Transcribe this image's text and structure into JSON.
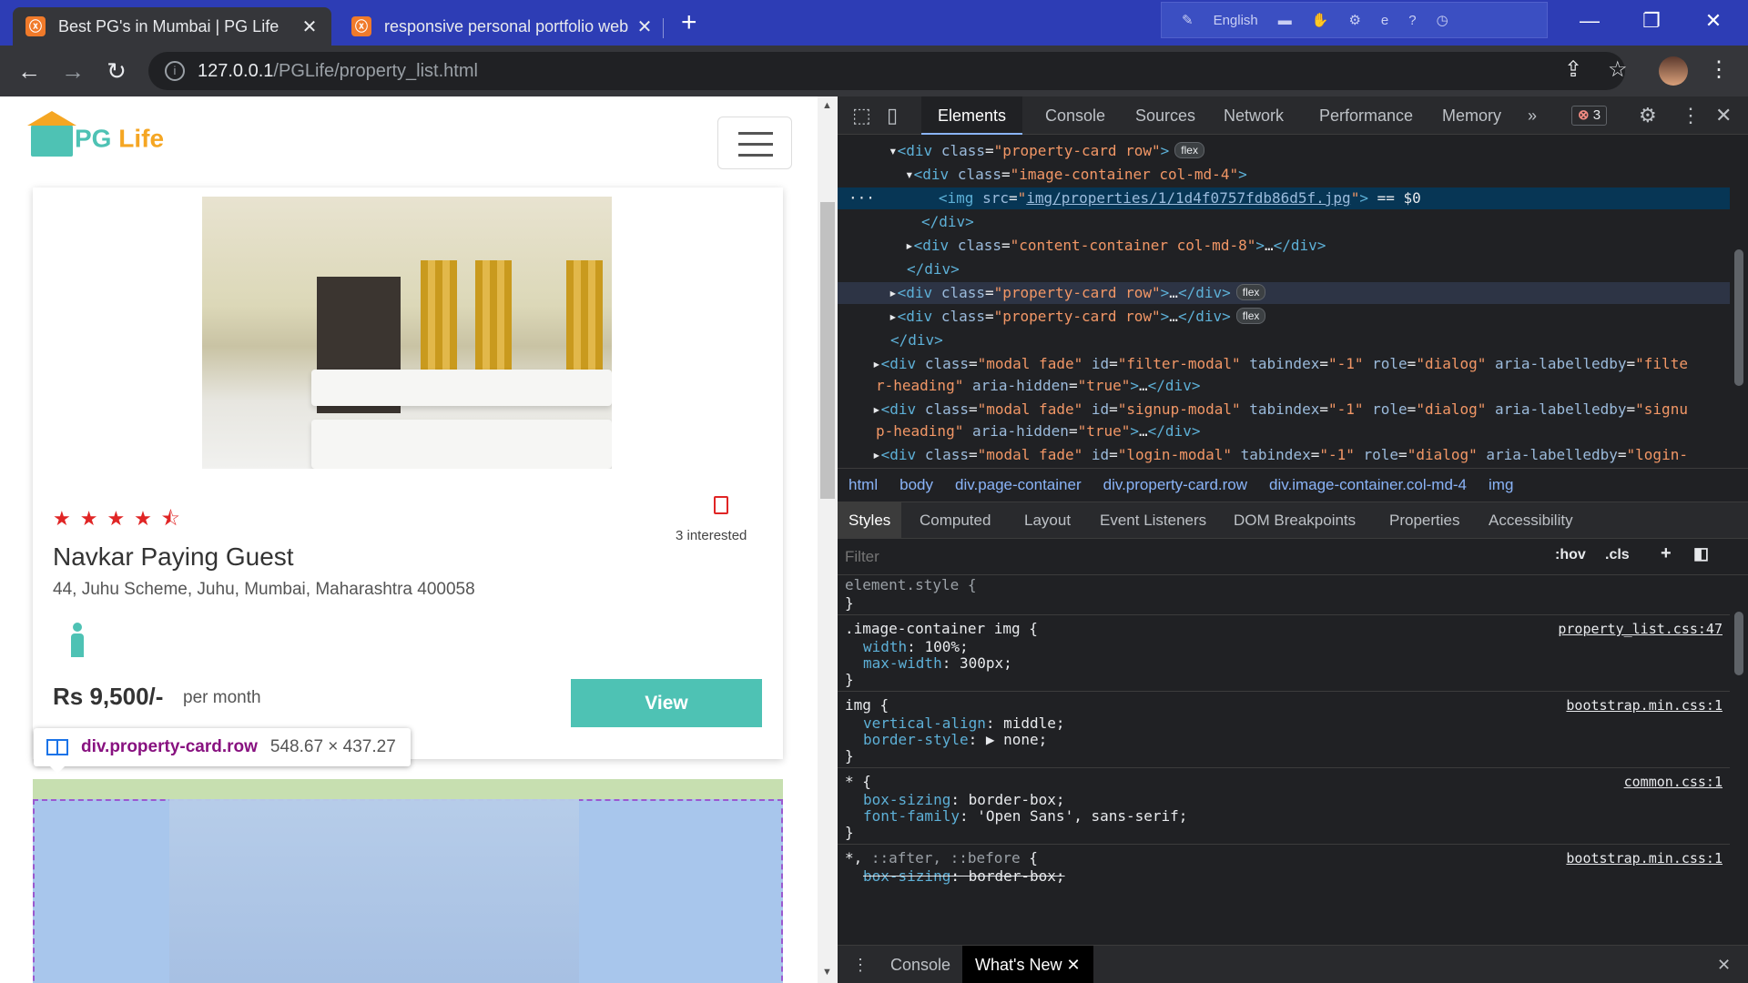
{
  "browser": {
    "tabs": [
      {
        "title": "Best PG's in Mumbai | PG Life",
        "favicon": "xampp-icon",
        "active": true
      },
      {
        "title": "responsive personal portfolio web",
        "favicon": "xampp-icon",
        "active": false
      }
    ],
    "new_tab_label": "+",
    "systray_language": "English",
    "url_host": "127.0.0.1",
    "url_path": "/PGLife/property_list.html"
  },
  "page": {
    "logo_text_pg": "PG",
    "logo_text_life": " Life",
    "property": {
      "rating_stars": 4.5,
      "interested_text": "3 interested",
      "name": "Navkar Paying Guest",
      "address": "44, Juhu Scheme, Juhu, Mumbai, Maharashtra 400058",
      "gender_icon": "male-icon",
      "rent": "Rs 9,500/-",
      "rent_period": "per month",
      "view_label": "View"
    },
    "inspect_tooltip": {
      "tag": "div.property-card.row",
      "dimensions": "548.67 × 437.27"
    }
  },
  "devtools": {
    "tabs": [
      "Elements",
      "Console",
      "Sources",
      "Network",
      "Performance",
      "Memory"
    ],
    "active_tab": "Elements",
    "more_tabs": "»",
    "error_count": "3",
    "breadcrumbs": [
      "html",
      "body",
      "div.page-container",
      "div.property-card.row",
      "div.image-container.col-md-4",
      "img"
    ],
    "sub_tabs": [
      "Styles",
      "Computed",
      "Layout",
      "Event Listeners",
      "DOM Breakpoints",
      "Properties",
      "Accessibility"
    ],
    "active_sub_tab": "Styles",
    "filter_placeholder": "Filter",
    "filter_hov": ":hov",
    "filter_cls": ".cls",
    "img_src": "img/properties/1/1d4f0757fdb86d5f.jpg",
    "selected_suffix": " == $0",
    "styles": {
      "element_style": "element.style {",
      "rule1_selector": ".image-container img {",
      "rule1_source": "property_list.css:47",
      "rule1_p1": "width",
      "rule1_v1": "100%;",
      "rule1_p2": "max-width",
      "rule1_v2": "300px;",
      "rule2_selector": "img {",
      "rule2_source": "bootstrap.min.css:1",
      "rule2_p1": "vertical-align",
      "rule2_v1": "middle;",
      "rule2_p2": "border-style",
      "rule2_v2": "▶ none;",
      "rule3_selector": "* {",
      "rule3_source": "common.css:1",
      "rule3_p1": "box-sizing",
      "rule3_v1": "border-box;",
      "rule3_p2": "font-family",
      "rule3_v2": "'Open Sans', sans-serif;",
      "rule4_selector_a": "*, ",
      "rule4_selector_b": "::after, ::before",
      "rule4_selector_c": " {",
      "rule4_source": "bootstrap.min.css:1",
      "rule4_p1": "box-sizing",
      "rule4_v1": "border-box;",
      "close_brace": "}"
    },
    "drawer_tabs": [
      "Console",
      "What's New"
    ]
  },
  "colors": {
    "brand_teal": "#4ec2b4",
    "brand_orange": "#f5a623",
    "star_red": "#e02525",
    "tab_bar": "#2d3db5"
  }
}
